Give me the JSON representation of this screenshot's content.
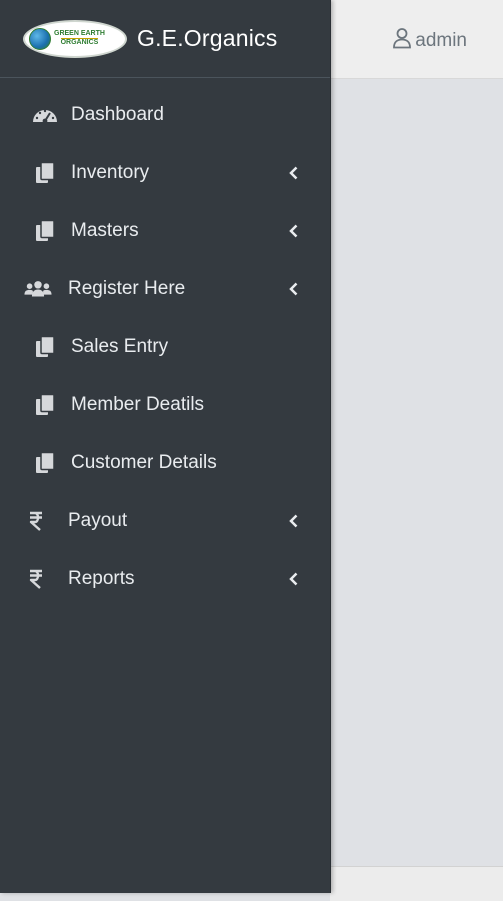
{
  "brand": {
    "logo_line1": "GREEN EARTH",
    "logo_line2": "ORGANICS",
    "name": "G.E.Organics"
  },
  "header": {
    "user_label": "admin",
    "user_icon": "user-icon"
  },
  "sidebar": {
    "items": [
      {
        "label": "Dashboard",
        "icon": "tachometer-icon",
        "has_submenu": false
      },
      {
        "label": "Inventory",
        "icon": "copy-icon",
        "has_submenu": true
      },
      {
        "label": "Masters",
        "icon": "copy-icon",
        "has_submenu": true
      },
      {
        "label": "Register Here",
        "icon": "users-icon",
        "has_submenu": true
      },
      {
        "label": "Sales Entry",
        "icon": "copy-icon",
        "has_submenu": false
      },
      {
        "label": "Member Deatils",
        "icon": "copy-icon",
        "has_submenu": false
      },
      {
        "label": "Customer Details",
        "icon": "copy-icon",
        "has_submenu": false
      },
      {
        "label": "Payout",
        "icon": "rupee-icon",
        "has_submenu": true
      },
      {
        "label": "Reports",
        "icon": "rupee-icon",
        "has_submenu": true
      }
    ]
  },
  "colors": {
    "sidebar_bg": "#343a40",
    "sidebar_text": "#e9ecef",
    "content_bg": "#dfe1e5",
    "topbar_bg": "#eeeeee"
  }
}
